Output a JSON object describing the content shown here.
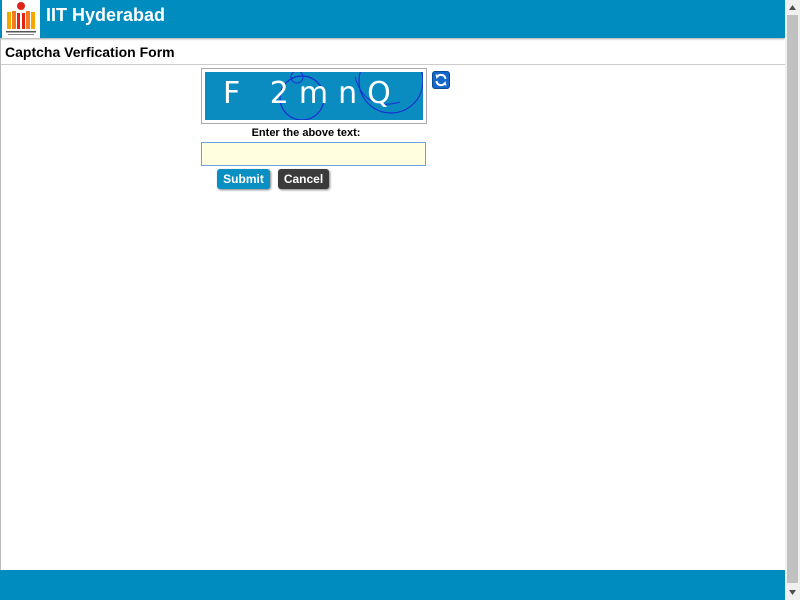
{
  "header": {
    "title": "IIT Hyderabad",
    "logo_icon": "iith-logo-icon"
  },
  "form": {
    "title": "Captcha Verfication Form",
    "captcha_text": "F 2mnQ",
    "prompt": "Enter the above text:",
    "input_value": "",
    "submit_label": "Submit",
    "cancel_label": "Cancel",
    "refresh_icon": "refresh-icon"
  },
  "colors": {
    "brand": "#008cbf",
    "submit": "#0a8fc2",
    "cancel": "#3b3b3b",
    "input_bg": "#ffffe0"
  }
}
